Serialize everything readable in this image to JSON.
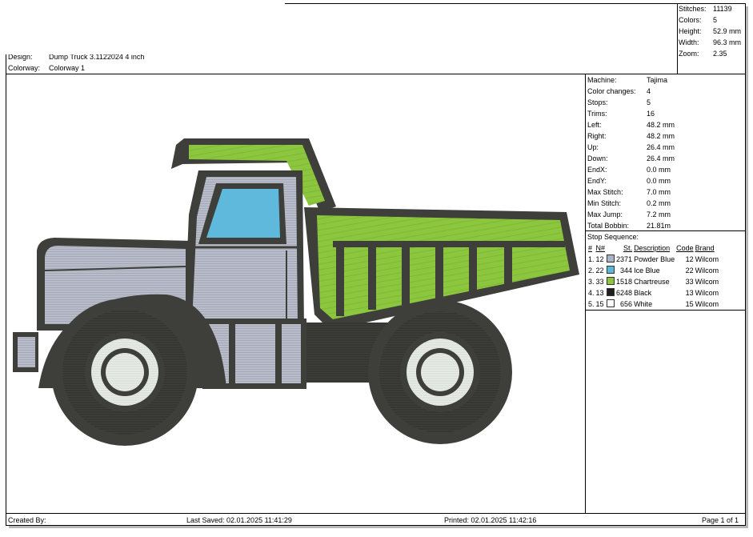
{
  "header": {
    "design_label": "Design:",
    "design_value": "Dump Truck 3.1122024 4 inch",
    "colorway_label": "Colorway:",
    "colorway_value": "Colorway 1"
  },
  "summary": [
    {
      "label": "Stitches:",
      "value": "11139"
    },
    {
      "label": "Colors:",
      "value": "5"
    },
    {
      "label": "Height:",
      "value": "52.9 mm"
    },
    {
      "label": "Width:",
      "value": "96.3 mm"
    },
    {
      "label": "Zoom:",
      "value": "2.35"
    }
  ],
  "machine_info": [
    {
      "label": "Machine:",
      "value": "Tajima"
    },
    {
      "label": "Color changes:",
      "value": "4"
    },
    {
      "label": "Stops:",
      "value": "5"
    },
    {
      "label": "Trims:",
      "value": "16"
    },
    {
      "label": "Left:",
      "value": "48.2 mm"
    },
    {
      "label": "Right:",
      "value": "48.2 mm"
    },
    {
      "label": "Up:",
      "value": "26.4 mm"
    },
    {
      "label": "Down:",
      "value": "26.4 mm"
    },
    {
      "label": "EndX:",
      "value": "0.0 mm"
    },
    {
      "label": "EndY:",
      "value": "0.0 mm"
    },
    {
      "label": "Max Stitch:",
      "value": "7.0 mm"
    },
    {
      "label": "Min Stitch:",
      "value": "0.2 mm"
    },
    {
      "label": "Max Jump:",
      "value": "7.2 mm"
    },
    {
      "label": "Total Bobbin:",
      "value": "21.81m"
    }
  ],
  "stop_sequence": {
    "title": "Stop Sequence:",
    "headers": {
      "num": "#",
      "n": "N#",
      "st": "St.",
      "description": "Description",
      "code": "Code",
      "brand": "Brand"
    },
    "rows": [
      {
        "num": "1.",
        "n": "12",
        "color": "#a9b4c8",
        "st": "2371",
        "description": "Powder Blue",
        "code": "12",
        "brand": "Wilcom"
      },
      {
        "num": "2.",
        "n": "22",
        "color": "#5bb8d8",
        "st": "344",
        "description": "Ice Blue",
        "code": "22",
        "brand": "Wilcom"
      },
      {
        "num": "3.",
        "n": "33",
        "color": "#8cc63f",
        "st": "1518",
        "description": "Chartreuse",
        "code": "33",
        "brand": "Wilcom"
      },
      {
        "num": "4.",
        "n": "13",
        "color": "#1f1f1f",
        "st": "6248",
        "description": "Black",
        "code": "13",
        "brand": "Wilcom"
      },
      {
        "num": "5.",
        "n": "15",
        "color": "#ffffff",
        "st": "656",
        "description": "White",
        "code": "15",
        "brand": "Wilcom"
      }
    ]
  },
  "footer": {
    "created_by": "Created By:",
    "last_saved": "Last Saved: 02.01.2025 11:41:29",
    "printed": "Printed: 02.01.2025 11:42:16",
    "page": "Page 1 of 1"
  },
  "colors": {
    "truck_body": "#b9bcc9",
    "window": "#5fb9dc",
    "dump_bed": "#8cc63f",
    "outline": "#3e3f3a",
    "hubcap": "#e8ece8"
  }
}
